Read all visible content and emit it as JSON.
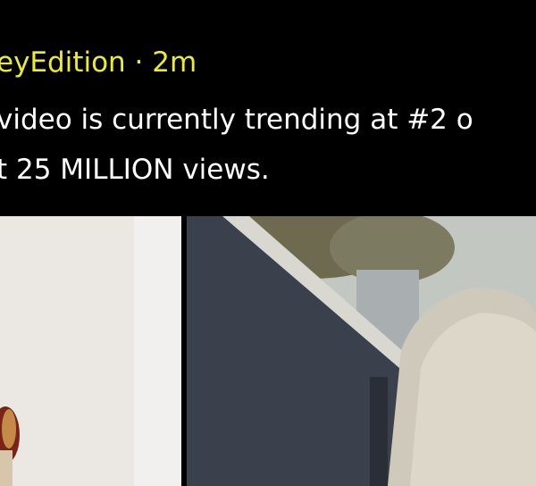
{
  "post": {
    "author": "eyEdition",
    "separator": "·",
    "time": "2m",
    "text_lines": [
      " video is currently trending at #2 o",
      "t 25 MILLION views."
    ]
  },
  "media": {
    "left_frame": "photo-left",
    "right_frame": "photo-right"
  }
}
